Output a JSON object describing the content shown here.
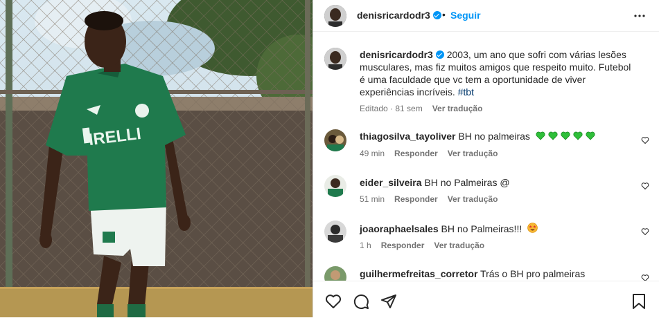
{
  "post": {
    "username": "denisricardodr3",
    "follow_label": "Seguir",
    "separator": "•",
    "more_label": "•••"
  },
  "caption": {
    "username": "denisricardodr3",
    "text": " 2003, um ano que sofri com várias lesões musculares, mas fiz muitos amigos que respeito muito. Futebol é uma faculdade que vc tem a oportunidade de viver experiências incríveis. ",
    "hashtag": "#tbt",
    "edited": "Editado · 81 sem",
    "see_translation": "Ver tradução"
  },
  "comments": [
    {
      "username": "thiagosilva_tayoliver",
      "text": " BH no palmeiras ",
      "time": "49 min",
      "reply": "Responder",
      "translate": "Ver tradução",
      "emoji": "green-hearts"
    },
    {
      "username": "eider_silveira",
      "text": " BH no Palmeiras @",
      "time": "51 min",
      "reply": "Responder",
      "translate": "Ver tradução"
    },
    {
      "username": "joaoraphaelsales",
      "text": " BH no Palmeiras!!!",
      "time": "1 h",
      "reply": "Responder",
      "translate": "Ver tradução",
      "emoji": "star-struck"
    },
    {
      "username": "guilhermefreitas_corretor",
      "text": " Trás o BH pro palmeiras"
    }
  ],
  "colors": {
    "accent": "#0095f6",
    "hashtag": "#00376b",
    "jersey": "#1f7a4d",
    "heart_green": "#2fbf3a"
  }
}
